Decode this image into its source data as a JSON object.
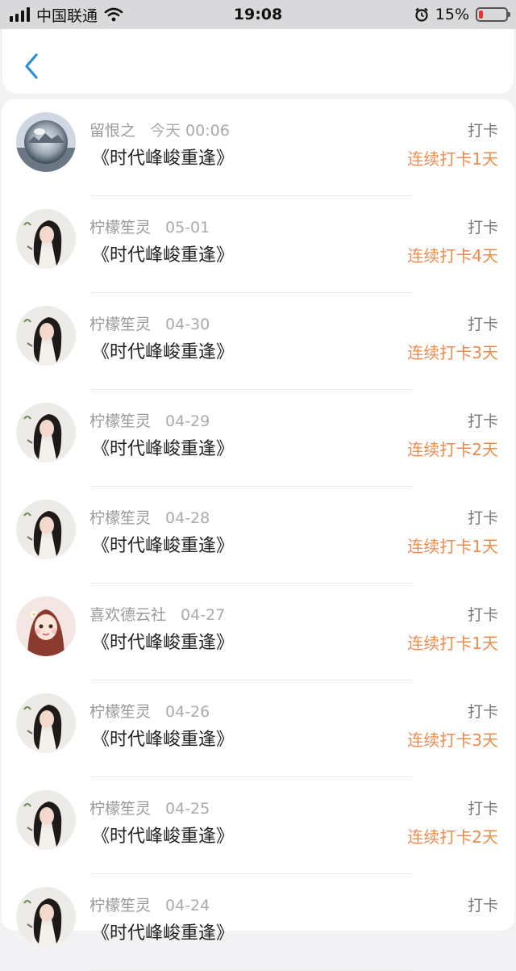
{
  "status_bar": {
    "carrier": "中国联通",
    "time": "19:08",
    "battery": "15%",
    "battery_level": 0.15
  },
  "nav": {
    "back_icon": "chevron-left-icon"
  },
  "colors": {
    "accent": "#f08a4b",
    "back": "#2b8fd8"
  },
  "entries": [
    {
      "name": "留恨之",
      "date": "今天 00:06",
      "book": "《时代峰峻重逢》",
      "type": "打卡",
      "streak": "连续打卡1天",
      "avatar": "crystal-ball"
    },
    {
      "name": "柠檬笙灵",
      "date": "05-01",
      "book": "《时代峰峻重逢》",
      "type": "打卡",
      "streak": "连续打卡4天",
      "avatar": "girl"
    },
    {
      "name": "柠檬笙灵",
      "date": "04-30",
      "book": "《时代峰峻重逢》",
      "type": "打卡",
      "streak": "连续打卡3天",
      "avatar": "girl"
    },
    {
      "name": "柠檬笙灵",
      "date": "04-29",
      "book": "《时代峰峻重逢》",
      "type": "打卡",
      "streak": "连续打卡2天",
      "avatar": "girl"
    },
    {
      "name": "柠檬笙灵",
      "date": "04-28",
      "book": "《时代峰峻重逢》",
      "type": "打卡",
      "streak": "连续打卡1天",
      "avatar": "girl"
    },
    {
      "name": "喜欢德云社",
      "date": "04-27",
      "book": "《时代峰峻重逢》",
      "type": "打卡",
      "streak": "连续打卡1天",
      "avatar": "cartoon-girl"
    },
    {
      "name": "柠檬笙灵",
      "date": "04-26",
      "book": "《时代峰峻重逢》",
      "type": "打卡",
      "streak": "连续打卡3天",
      "avatar": "girl"
    },
    {
      "name": "柠檬笙灵",
      "date": "04-25",
      "book": "《时代峰峻重逢》",
      "type": "打卡",
      "streak": "连续打卡2天",
      "avatar": "girl"
    },
    {
      "name": "柠檬笙灵",
      "date": "04-24",
      "book": "《时代峰峻重逢》",
      "type": "打卡",
      "streak": "",
      "avatar": "girl"
    }
  ]
}
